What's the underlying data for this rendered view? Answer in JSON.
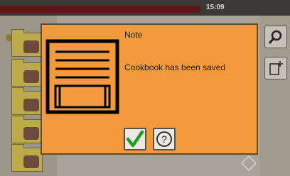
{
  "status_bar": {
    "time": "15:09"
  },
  "dialog": {
    "title": "Note",
    "message": "Cookbook has been saved",
    "icons": {
      "main": "document-save-icon",
      "ok": "checkmark-icon",
      "help": "question-mark-icon"
    }
  },
  "background": {
    "icons": [
      "folder-icon",
      "search-icon",
      "new-document-icon"
    ]
  },
  "colors": {
    "dialog_bg": "#f39a3d",
    "check_green": "#1f9e1f",
    "top_red": "#5e1717"
  }
}
